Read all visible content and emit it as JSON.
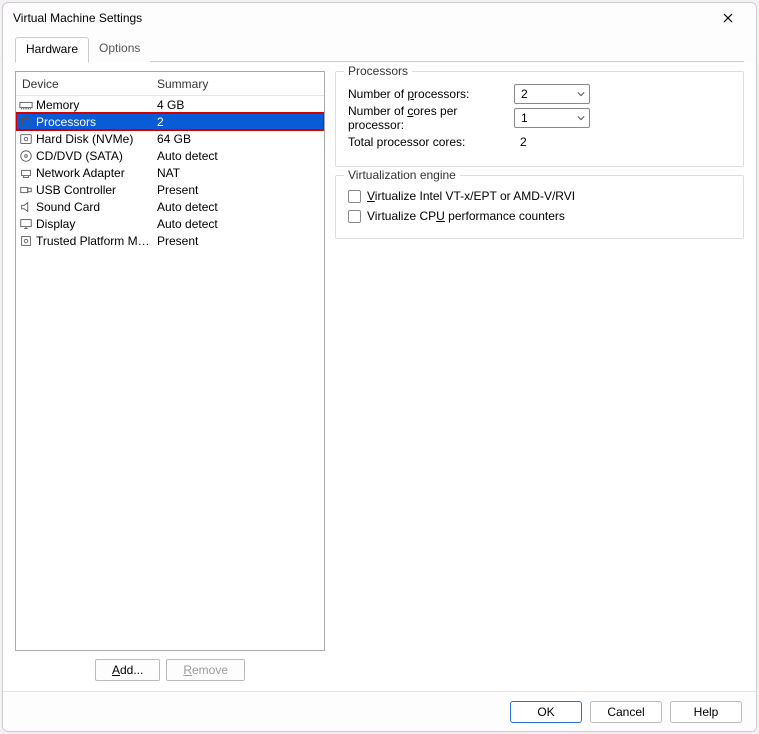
{
  "window": {
    "title": "Virtual Machine Settings"
  },
  "tabs": {
    "hardware": "Hardware",
    "options": "Options",
    "active": "hardware"
  },
  "listHeaders": {
    "device": "Device",
    "summary": "Summary"
  },
  "devices": [
    {
      "name": "Memory",
      "summary": "4 GB",
      "icon": "memory"
    },
    {
      "name": "Processors",
      "summary": "2",
      "icon": "cpu",
      "selected": true,
      "highlight": true
    },
    {
      "name": "Hard Disk (NVMe)",
      "summary": "64 GB",
      "icon": "disk"
    },
    {
      "name": "CD/DVD (SATA)",
      "summary": "Auto detect",
      "icon": "cd"
    },
    {
      "name": "Network Adapter",
      "summary": "NAT",
      "icon": "net"
    },
    {
      "name": "USB Controller",
      "summary": "Present",
      "icon": "usb"
    },
    {
      "name": "Sound Card",
      "summary": "Auto detect",
      "icon": "sound"
    },
    {
      "name": "Display",
      "summary": "Auto detect",
      "icon": "display"
    },
    {
      "name": "Trusted Platform Mo…",
      "summary": "Present",
      "icon": "tpm"
    }
  ],
  "buttons": {
    "add": "Add...",
    "remove": "Remove"
  },
  "processorsGroup": {
    "title": "Processors",
    "numProcLabelPre": "Number of ",
    "numProcLabelU": "p",
    "numProcLabelPost": "rocessors:",
    "numCoresLabelPre": "Number of ",
    "numCoresLabelU": "c",
    "numCoresLabelPost": "ores per processor:",
    "totalLabel": "Total processor cores:",
    "numProcValue": "2",
    "numCoresValue": "1",
    "totalValue": "2"
  },
  "virtGroup": {
    "title": "Virtualization engine",
    "vtxPre": "",
    "vtxU": "V",
    "vtxPost": "irtualize Intel VT-x/EPT or AMD-V/RVI",
    "perfPre": "Virtualize CP",
    "perfU": "U",
    "perfPost": " performance counters"
  },
  "footer": {
    "ok": "OK",
    "cancel": "Cancel",
    "help": "Help"
  }
}
